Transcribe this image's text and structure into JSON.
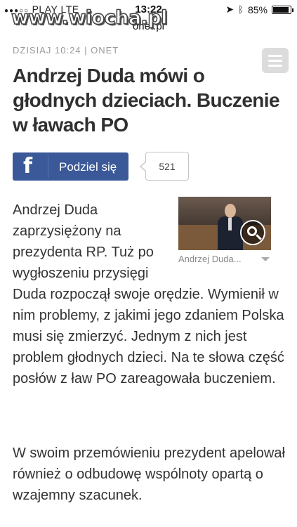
{
  "status_bar": {
    "carrier": "PLAY",
    "network": "LTE",
    "time": "13:22",
    "battery_percent": "85%",
    "battery_level": 0.85
  },
  "url_bar": {
    "host": "onet.pl"
  },
  "watermark": {
    "text": "www.wiocha.pl"
  },
  "article": {
    "meta": "DZISIAJ 10:24 | ONET",
    "headline": "Andrzej Duda mówi o głodnych dzieciach. Buczenie w ławach PO",
    "share": {
      "label": "Podziel się",
      "count": "521",
      "icon": "facebook-icon"
    },
    "image_caption": "Andrzej Duda...",
    "paragraph1_wrapped": "Andrzej Duda zaprzysiężony na prezydenta RP. Tuż po wygłoszeniu przysięgi",
    "paragraph1_rest": "Duda rozpoczął swoje orędzie. Wymienił w nim problemy, z jakimi jego zdaniem Polska musi się zmierzyć. Jednym z nich jest problem głodnych dzieci. Na te słowa część posłów z ław PO zareagowała buczeniem.",
    "paragraph2": "W swoim przemówieniu prezydent apelował również o odbudowę wspólnoty opartą o wzajemny szacunek."
  },
  "colors": {
    "facebook_blue": "#3b5998",
    "meta_gray": "#9a9a9a",
    "text": "#333333"
  }
}
